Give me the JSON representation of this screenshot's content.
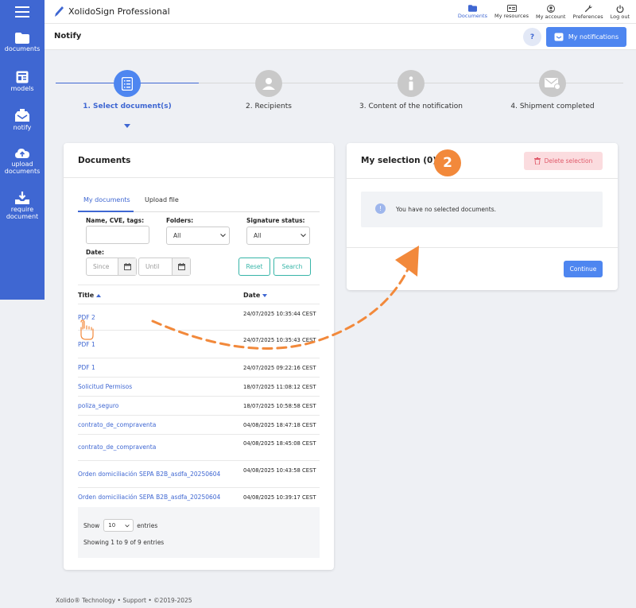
{
  "app": {
    "brand": "XolidoSign Professional",
    "page_title": "Notify"
  },
  "sidebar": {
    "items": [
      {
        "label": "documents",
        "icon": "folder-icon"
      },
      {
        "label": "models",
        "icon": "template-icon"
      },
      {
        "label": "notify",
        "icon": "inbox-notify-icon"
      },
      {
        "label": "upload documents",
        "icon": "cloud-upload-icon"
      },
      {
        "label": "require document",
        "icon": "download-tray-icon"
      }
    ]
  },
  "topnav": {
    "items": [
      {
        "label": "Documents",
        "icon": "folder-icon",
        "active": true
      },
      {
        "label": "My resources",
        "icon": "id-card-icon"
      },
      {
        "label": "My account",
        "icon": "user-icon"
      },
      {
        "label": "Preferences",
        "icon": "wrench-icon"
      },
      {
        "label": "Log out",
        "icon": "power-icon"
      }
    ]
  },
  "subheader": {
    "help_label": "?",
    "notifications_label": "My notifications"
  },
  "stepper": {
    "steps": [
      {
        "label": "1. Select document(s)",
        "active": true
      },
      {
        "label": "2. Recipients"
      },
      {
        "label": "3. Content of the notification"
      },
      {
        "label": "4. Shipment completed"
      }
    ]
  },
  "documents": {
    "title": "Documents",
    "tabs": [
      "My documents",
      "Upload file"
    ],
    "filters": {
      "name_label": "Name, CVE, tags:",
      "folders_label": "Folders:",
      "folders_value": "All",
      "status_label": "Signature status:",
      "status_value": "All",
      "date_label": "Date:",
      "since_placeholder": "Since",
      "until_placeholder": "Until",
      "reset_label": "Reset",
      "search_label": "Search"
    },
    "columns": {
      "title": "Title",
      "date": "Date"
    },
    "rows": [
      {
        "title": "PDF 2",
        "date": "24/07/2025 10:35:44 CEST"
      },
      {
        "title": "PDF 1",
        "date": "24/07/2025 10:35:43 CEST"
      },
      {
        "title": "PDF 1",
        "date": "24/07/2025 09:22:16 CEST"
      },
      {
        "title": "Solicitud Permisos",
        "date": "18/07/2025 11:08:12 CEST"
      },
      {
        "title": "poliza_seguro",
        "date": "18/07/2025 10:58:58 CEST"
      },
      {
        "title": "contrato_de_compraventa",
        "date": "04/08/2025 18:47:18 CEST"
      },
      {
        "title": "contrato_de_compraventa",
        "date": "04/08/2025 18:45:08 CEST"
      },
      {
        "title": "Orden domiciliación SEPA B2B_asdfa_20250604",
        "date": "04/08/2025 10:43:58 CEST"
      },
      {
        "title": "Orden domiciliación SEPA B2B_asdfa_20250604",
        "date": "04/08/2025 10:39:17 CEST"
      }
    ],
    "show_label": "Show",
    "entries_value": "10",
    "entries_label": "entries",
    "showing_text": "Showing 1 to 9 of 9 entries"
  },
  "selection": {
    "title": "My selection (0)",
    "step_badge": "2",
    "delete_label": "Delete selection",
    "empty_message": "You have no selected documents.",
    "continue_label": "Continue"
  },
  "footer": {
    "text": "Xolido® Technology • Support • ©2019-2025"
  },
  "colors": {
    "primary": "#3f67d2",
    "button": "#4e86f0",
    "accent_orange": "#f2893b",
    "teal": "#37b5a8",
    "danger": "#e05b6b"
  }
}
